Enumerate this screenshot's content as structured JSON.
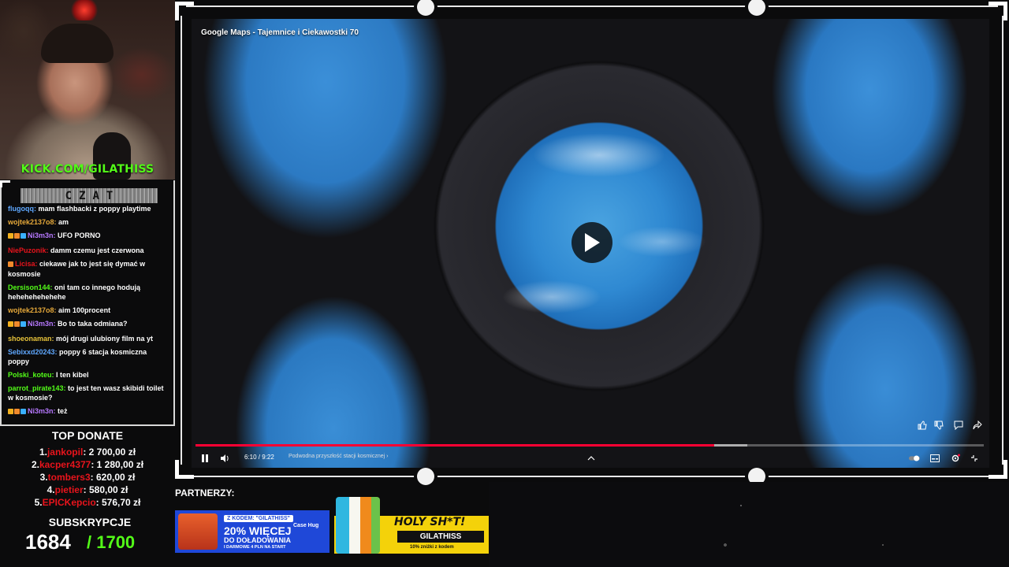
{
  "stream": {
    "kick_url": "KICK.COM/GILATHISS"
  },
  "chat": {
    "header": "CZAT",
    "messages": [
      {
        "user": "flugoqq:",
        "user_color": "#5fa8ff",
        "badges": [],
        "text": " mam flashbacki z poppy playtime"
      },
      {
        "user": "wojtek2137o8:",
        "user_color": "#e6a93a",
        "badges": [],
        "text": " am"
      },
      {
        "user": "Ni3m3n:",
        "user_color": "#b779ff",
        "badges": [
          "#f2b01e",
          "#f08a2c",
          "#3ab0ff"
        ],
        "text": " UFO PORNO"
      },
      {
        "user": "NiePuzonik:",
        "user_color": "#e8141c",
        "badges": [],
        "text": " damm czemu jest czerwona"
      },
      {
        "user": "Licisa:",
        "user_color": "#e8141c",
        "badges": [
          "#f08a2c"
        ],
        "text": " ciekawe jak to jest się dymać w kosmosie"
      },
      {
        "user": "Dersison144:",
        "user_color": "#53fc18",
        "badges": [],
        "text": " oni tam co innego hodują hehehehehehehe"
      },
      {
        "user": "wojtek2137o8:",
        "user_color": "#e6a93a",
        "badges": [],
        "text": " aim 100procent"
      },
      {
        "user": "Ni3m3n:",
        "user_color": "#b779ff",
        "badges": [
          "#f2b01e",
          "#f08a2c",
          "#3ab0ff"
        ],
        "text": " Bo to taka odmiana?"
      },
      {
        "user": "shoeonaman:",
        "user_color": "#e6c23a",
        "badges": [],
        "text": " mój drugi ulubiony film na yt"
      },
      {
        "user": "Sebixxd20243:",
        "user_color": "#5fa8ff",
        "badges": [],
        "text": " poppy 6 stacja kosmiczna poppy"
      },
      {
        "user": "Polski_koteu:",
        "user_color": "#53fc18",
        "badges": [],
        "text": " I ten kibel"
      },
      {
        "user": "parrot_pirate143:",
        "user_color": "#53fc18",
        "badges": [],
        "text": " to jest ten wasz skibidi toilet w kosmosie?"
      },
      {
        "user": "Ni3m3n:",
        "user_color": "#b779ff",
        "badges": [
          "#f2b01e",
          "#f08a2c",
          "#3ab0ff"
        ],
        "text": " też"
      }
    ]
  },
  "top_donate": {
    "title": "TOP DONATE",
    "rows": [
      {
        "rank": "1.",
        "name": "jankopil",
        "amount": ": 2 700,00 zł"
      },
      {
        "rank": "2.",
        "name": "kacper4377",
        "amount": ": 1 280,00 zł"
      },
      {
        "rank": "3.",
        "name": "tombers3",
        "amount": ": 620,00 zł"
      },
      {
        "rank": "4.",
        "name": "pietier",
        "amount": ": 580,00 zł"
      },
      {
        "rank": "5.",
        "name": "EPICKepcio",
        "amount": ": 576,70 zł"
      }
    ]
  },
  "subscriptions": {
    "label": "SUBSKRYPCJE",
    "count": "1684",
    "goal": "/ 1700"
  },
  "video": {
    "title": "Google Maps - Tajemnice i Ciekawostki 70",
    "time": "6:10 / 9:22",
    "chapter": "Podwodna przyszłość stacji kosmicznej",
    "chapter_arrow": "›",
    "progress": 0.658,
    "buffered": 0.7
  },
  "partners": {
    "label": "PARTNERZY:",
    "banner1": {
      "code": "Z KODEM: \"GILATHISS\"",
      "brand": "Case Hug",
      "headline": "20% WIĘCEJ",
      "subline": "DO DOŁADOWANIA",
      "tiny": "I DARMOWE 4 PLN NA START"
    },
    "banner2": {
      "headline": "HOLY SH*T!",
      "code": "GILATHISS",
      "disclaimer": "10% zniżki z kodem"
    }
  },
  "colors": {
    "kick_green": "#53fc18",
    "donate_red": "#e8141c",
    "progress_red": "#ff0033"
  }
}
